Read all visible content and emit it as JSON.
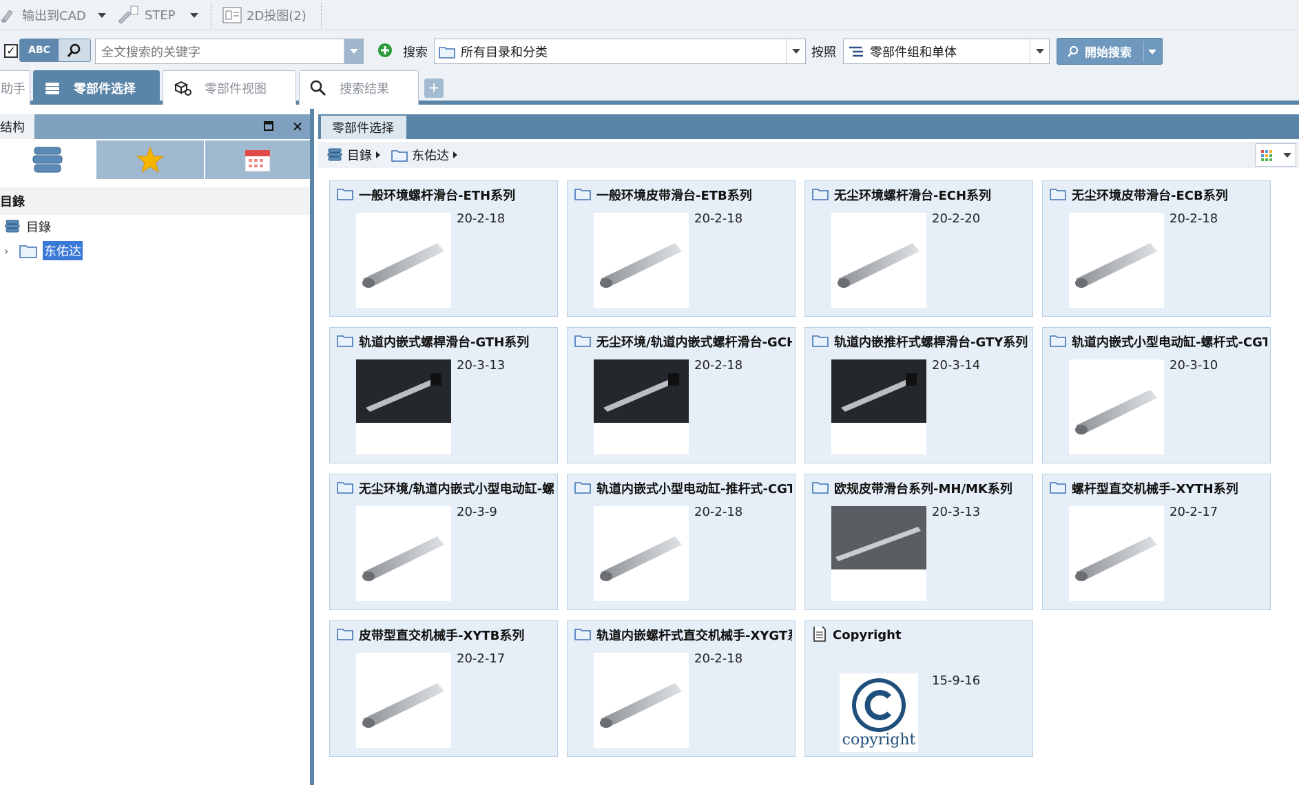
{
  "toolbar": {
    "export_cad": "输出到CAD",
    "step": "STEP",
    "projection": "2D投图(2)"
  },
  "search": {
    "mode_label": "ABC",
    "placeholder": "全文搜索的关键字",
    "search_label": "搜索",
    "scope_value": "所有目录和分类",
    "by_label": "按照",
    "type_value": "零部件组和单体",
    "start_button": "開始搜索"
  },
  "tabs": [
    {
      "label": "助手"
    },
    {
      "label": "零部件选择"
    },
    {
      "label": "零部件视图"
    },
    {
      "label": "搜索结果"
    }
  ],
  "tab_add": "+",
  "left_panel": {
    "title": "结构",
    "section": "目錄",
    "tree": [
      {
        "label": "目錄"
      },
      {
        "label": "东佑达"
      }
    ]
  },
  "right_panel": {
    "tab": "零部件选择",
    "breadcrumb": [
      "目錄",
      "东佑达"
    ]
  },
  "colors": {
    "accent": "#5b85a8",
    "card_bg": "#e6eff7",
    "selection": "#3a78d8"
  },
  "cards": [
    {
      "title": "一般环境螺杆滑台-ETH系列",
      "date": "20-2-18",
      "icon": "folder-icon",
      "thumb": "light"
    },
    {
      "title": "一般环境皮带滑台-ETB系列",
      "date": "20-2-18",
      "icon": "folder-icon",
      "thumb": "light"
    },
    {
      "title": "无尘环境螺杆滑台-ECH系列",
      "date": "20-2-20",
      "icon": "folder-icon",
      "thumb": "light"
    },
    {
      "title": "无尘环境皮带滑台-ECB系列",
      "date": "20-2-18",
      "icon": "folder-icon",
      "thumb": "light"
    },
    {
      "title": "轨道内嵌式螺桿滑台-GTH系列",
      "date": "20-3-13",
      "icon": "folder-icon",
      "thumb": "dark"
    },
    {
      "title": "无尘环境/轨道内嵌式螺杆滑台-GCH",
      "date": "20-2-18",
      "icon": "folder-icon",
      "thumb": "dark"
    },
    {
      "title": "轨道内嵌推杆式螺桿滑台-GTY系列",
      "date": "20-3-14",
      "icon": "folder-icon",
      "thumb": "dark"
    },
    {
      "title": "轨道内嵌式小型电动缸-螺杆式-CGT",
      "date": "20-3-10",
      "icon": "folder-icon",
      "thumb": "light"
    },
    {
      "title": "无尘环境/轨道内嵌式小型电动缸-螺",
      "date": "20-3-9",
      "icon": "folder-icon",
      "thumb": "light"
    },
    {
      "title": "轨道内嵌式小型电动缸-推杆式-CGT",
      "date": "20-2-18",
      "icon": "folder-icon",
      "thumb": "light"
    },
    {
      "title": "欧规皮带滑台系列-MH/MK系列",
      "date": "20-3-13",
      "icon": "folder-icon",
      "thumb": "darkgray"
    },
    {
      "title": "螺杆型直交机械手-XYTH系列",
      "date": "20-2-17",
      "icon": "folder-icon",
      "thumb": "light"
    },
    {
      "title": "皮带型直交机械手-XYTB系列",
      "date": "20-2-17",
      "icon": "folder-icon",
      "thumb": "light"
    },
    {
      "title": "轨道内嵌螺杆式直交机械手-XYGT系",
      "date": "20-2-18",
      "icon": "folder-icon",
      "thumb": "light"
    },
    {
      "title": "Copyright",
      "date": "15-9-16",
      "icon": "document-icon",
      "thumb": "copyright",
      "thumb_caption": "copyright"
    }
  ]
}
